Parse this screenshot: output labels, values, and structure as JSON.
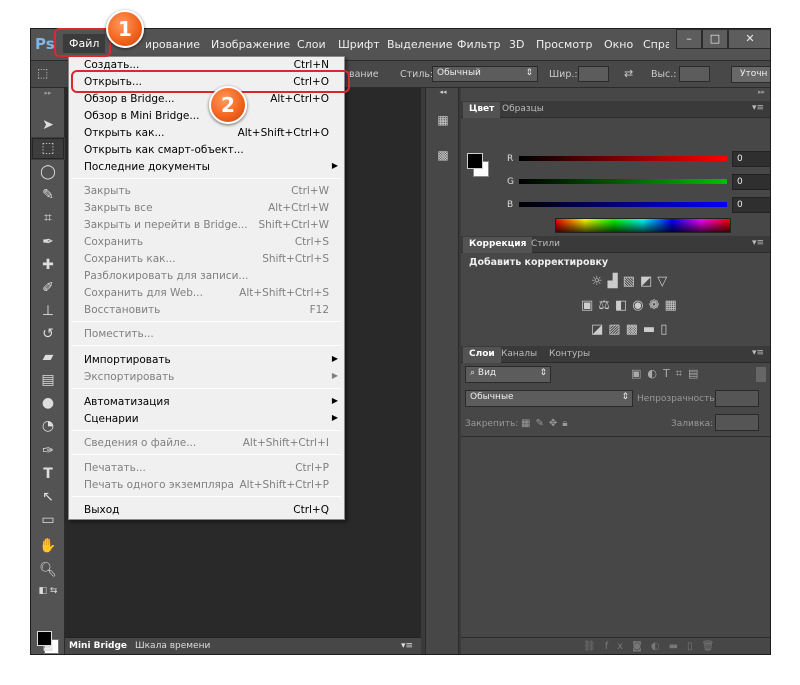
{
  "app": {
    "logo": "Ps",
    "menu": [
      "Файл",
      "Редактирование",
      "Изображение",
      "Слои",
      "Шрифт",
      "Выделение",
      "Фильтр",
      "3D",
      "Просмотр",
      "Окно",
      "Справка"
    ],
    "window_controls": {
      "minimize": "–",
      "maximize": "□",
      "close": "✕"
    }
  },
  "options_bar": {
    "label_1": "вание",
    "style_label": "Стиль:",
    "style_value": "Обычный",
    "width_label": "Шир.:",
    "height_label": "Выс.:",
    "refine_button": "Уточн"
  },
  "file_menu": {
    "items": [
      {
        "label": "Создать...",
        "shortcut": "Ctrl+N",
        "disabled": false
      },
      {
        "label": "Открыть...",
        "shortcut": "Ctrl+O",
        "disabled": false
      },
      {
        "label": "Обзор в Bridge...",
        "shortcut": "Alt+Ctrl+O",
        "disabled": false
      },
      {
        "label": "Обзор в Mini Bridge...",
        "shortcut": "",
        "disabled": false
      },
      {
        "label": "Открыть как...",
        "shortcut": "Alt+Shift+Ctrl+O",
        "disabled": false
      },
      {
        "label": "Открыть как смарт-объект...",
        "shortcut": "",
        "disabled": false
      },
      {
        "label": "Последние документы",
        "shortcut": "",
        "disabled": false,
        "submenu": true
      },
      {
        "label": "Закрыть",
        "shortcut": "Ctrl+W",
        "disabled": true
      },
      {
        "label": "Закрыть все",
        "shortcut": "Alt+Ctrl+W",
        "disabled": true
      },
      {
        "label": "Закрыть и перейти в Bridge...",
        "shortcut": "Shift+Ctrl+W",
        "disabled": true
      },
      {
        "label": "Сохранить",
        "shortcut": "Ctrl+S",
        "disabled": true
      },
      {
        "label": "Сохранить как...",
        "shortcut": "Shift+Ctrl+S",
        "disabled": true
      },
      {
        "label": "Разблокировать для записи...",
        "shortcut": "",
        "disabled": true
      },
      {
        "label": "Сохранить для Web...",
        "shortcut": "Alt+Shift+Ctrl+S",
        "disabled": true
      },
      {
        "label": "Восстановить",
        "shortcut": "F12",
        "disabled": true
      },
      {
        "label": "Поместить...",
        "shortcut": "",
        "disabled": true
      },
      {
        "label": "Импортировать",
        "shortcut": "",
        "disabled": false,
        "submenu": true
      },
      {
        "label": "Экспортировать",
        "shortcut": "",
        "disabled": true,
        "submenu": true
      },
      {
        "label": "Автоматизация",
        "shortcut": "",
        "disabled": false,
        "submenu": true
      },
      {
        "label": "Сценарии",
        "shortcut": "",
        "disabled": false,
        "submenu": true
      },
      {
        "label": "Сведения о файле...",
        "shortcut": "Alt+Shift+Ctrl+I",
        "disabled": true
      },
      {
        "label": "Печатать...",
        "shortcut": "Ctrl+P",
        "disabled": true
      },
      {
        "label": "Печать одного экземпляра",
        "shortcut": "Alt+Shift+Ctrl+P",
        "disabled": true
      },
      {
        "label": "Выход",
        "shortcut": "Ctrl+Q",
        "disabled": false
      }
    ]
  },
  "color_panel": {
    "tabs": [
      "Цвет",
      "Образцы"
    ],
    "channels": [
      {
        "label": "R",
        "value": "0",
        "color": "#ff0000"
      },
      {
        "label": "G",
        "value": "0",
        "color": "#00c000"
      },
      {
        "label": "B",
        "value": "0",
        "color": "#0000ff"
      }
    ]
  },
  "adjustments_panel": {
    "tabs": [
      "Коррекция",
      "Стили"
    ],
    "title": "Добавить корректировку"
  },
  "layers_panel": {
    "tabs": [
      "Слои",
      "Каналы",
      "Контуры"
    ],
    "filter": "Вид",
    "blend_mode": "Обычные",
    "opacity_label": "Непрозрачность:",
    "lock_label": "Закрепить:",
    "fill_label": "Заливка:"
  },
  "bottom_tabs": [
    "Mini Bridge",
    "Шкала времени"
  ],
  "annotations": {
    "badge_1": "1",
    "badge_2": "2"
  },
  "colors": {
    "highlight": "#d9282e",
    "badge": "#f2651f"
  }
}
